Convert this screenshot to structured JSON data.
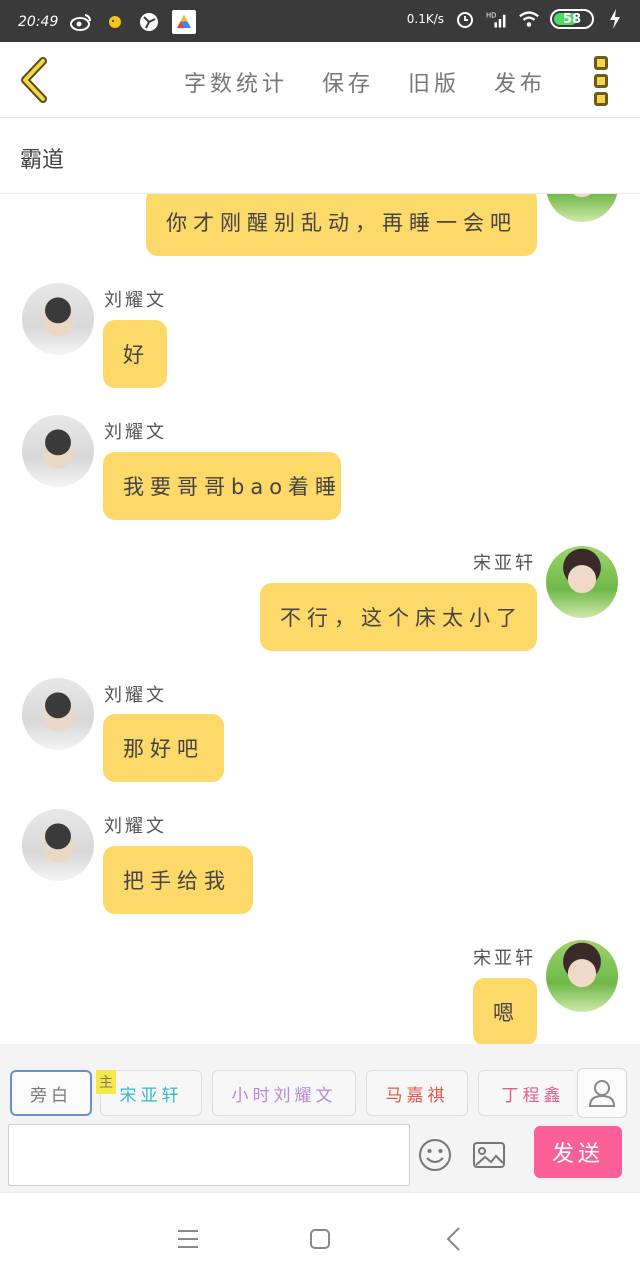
{
  "status_bar": {
    "time": "20:49",
    "net_speed": "0.1K/s",
    "signal": "HD",
    "battery": "58"
  },
  "toolbar": {
    "word_count": "字数统计",
    "save": "保存",
    "old_version": "旧版",
    "publish": "发布"
  },
  "story": {
    "title": "霸道"
  },
  "messages": [
    {
      "side": "right",
      "name": "",
      "text": "你才刚醒别乱动，再睡一会吧"
    },
    {
      "side": "left",
      "name": "刘耀文",
      "text": "好"
    },
    {
      "side": "left",
      "name": "刘耀文",
      "text": "我要哥哥bao着睡"
    },
    {
      "side": "right",
      "name": "宋亚轩",
      "text": "不行，这个床太小了"
    },
    {
      "side": "left",
      "name": "刘耀文",
      "text": "那好吧"
    },
    {
      "side": "left",
      "name": "刘耀文",
      "text": "把手给我"
    },
    {
      "side": "right",
      "name": "宋亚轩",
      "text": "嗯"
    }
  ],
  "roles": [
    {
      "label": "旁白",
      "color": "#777777"
    },
    {
      "label": "宋亚轩",
      "color": "#37b8c9",
      "tag": "主"
    },
    {
      "label": "小时刘耀文",
      "color": "#b68bd8"
    },
    {
      "label": "马嘉祺",
      "color": "#e0574f"
    },
    {
      "label": "丁程鑫",
      "color": "#e0608c"
    }
  ],
  "input": {
    "placeholder": "",
    "send": "发送"
  },
  "colors": {
    "bubble": "#fdd96a",
    "send_button": "#fb5f97",
    "accent": "#f5d44e"
  }
}
